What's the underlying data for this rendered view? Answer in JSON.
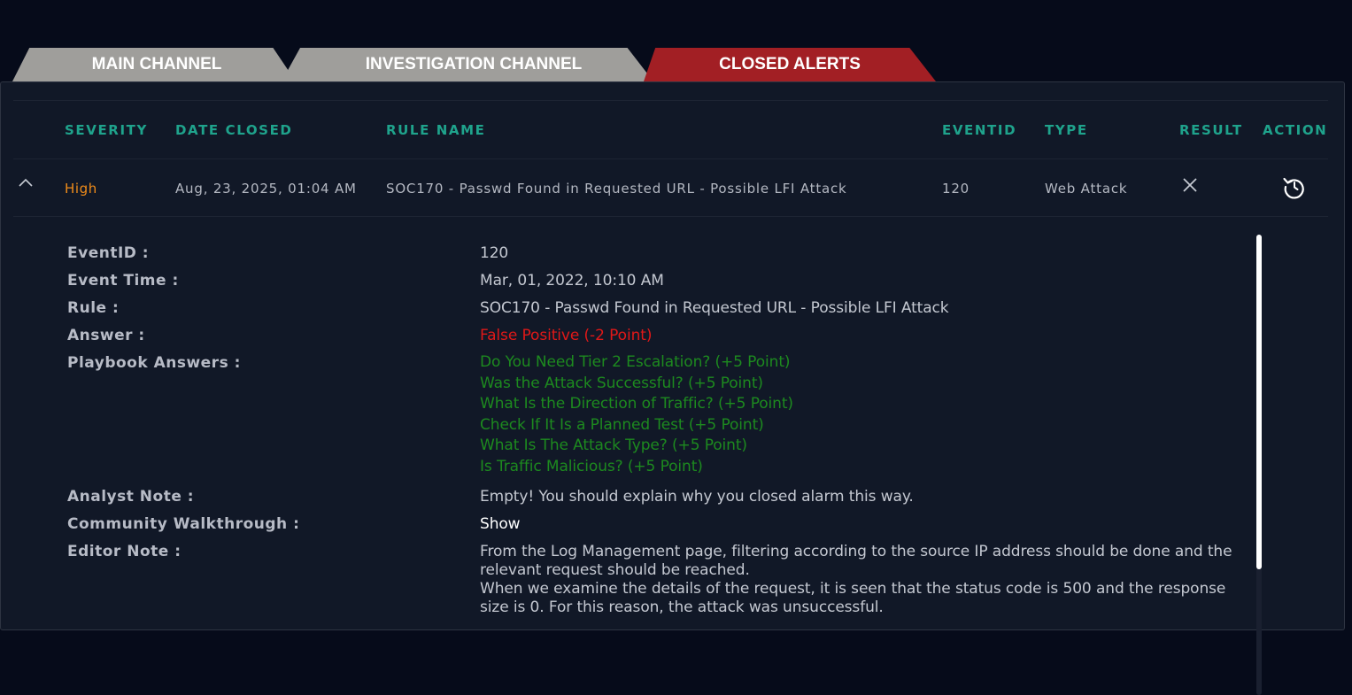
{
  "tabs": {
    "main": "MAIN CHANNEL",
    "investigation": "INVESTIGATION CHANNEL",
    "closed": "CLOSED ALERTS"
  },
  "table": {
    "headers": {
      "severity": "SEVERITY",
      "date_closed": "DATE CLOSED",
      "rule_name": "RULE NAME",
      "eventid": "EVENTID",
      "type": "TYPE",
      "result": "RESULT",
      "action": "ACTION"
    },
    "row": {
      "severity": "High",
      "date_closed": "Aug, 23, 2025, 01:04 AM",
      "rule_name": "SOC170 - Passwd Found in Requested URL - Possible LFI Attack",
      "eventid": "120",
      "type": "Web Attack",
      "result_icon": "close-x-icon",
      "action_icon": "restore-icon"
    }
  },
  "details": {
    "labels": {
      "eventid": "EventID :",
      "event_time": "Event Time :",
      "rule": "Rule :",
      "answer": "Answer :",
      "playbook": "Playbook Answers :",
      "analyst_note": "Analyst Note :",
      "community": "Community Walkthrough :",
      "editor_note": "Editor Note :"
    },
    "values": {
      "eventid": "120",
      "event_time": "Mar, 01, 2022, 10:10 AM",
      "rule": "SOC170 - Passwd Found in Requested URL - Possible LFI Attack",
      "answer": "False Positive (-2 Point)",
      "playbook": [
        "Do You Need Tier 2 Escalation? (+5 Point)",
        "Was the Attack Successful? (+5 Point)",
        "What Is the Direction of Traffic? (+5 Point)",
        "Check If It Is a Planned Test (+5 Point)",
        "What Is The Attack Type? (+5 Point)",
        "Is Traffic Malicious? (+5 Point)"
      ],
      "analyst_note": "Empty! You should explain why you closed alarm this way.",
      "community": "Show",
      "editor_note_1": "From the Log Management page, filtering according to the source IP address should be done and the relevant request should be reached.",
      "editor_note_2": "When we examine the details of the request, it is seen that the status code is 500 and the response size is 0. For this reason, the attack was unsuccessful."
    }
  },
  "colors": {
    "accent_teal": "#1fa38c",
    "severity_high": "#f08c1a",
    "answer_wrong": "#e01818",
    "answer_right": "#1d8a1f",
    "active_tab": "#a21f24"
  }
}
